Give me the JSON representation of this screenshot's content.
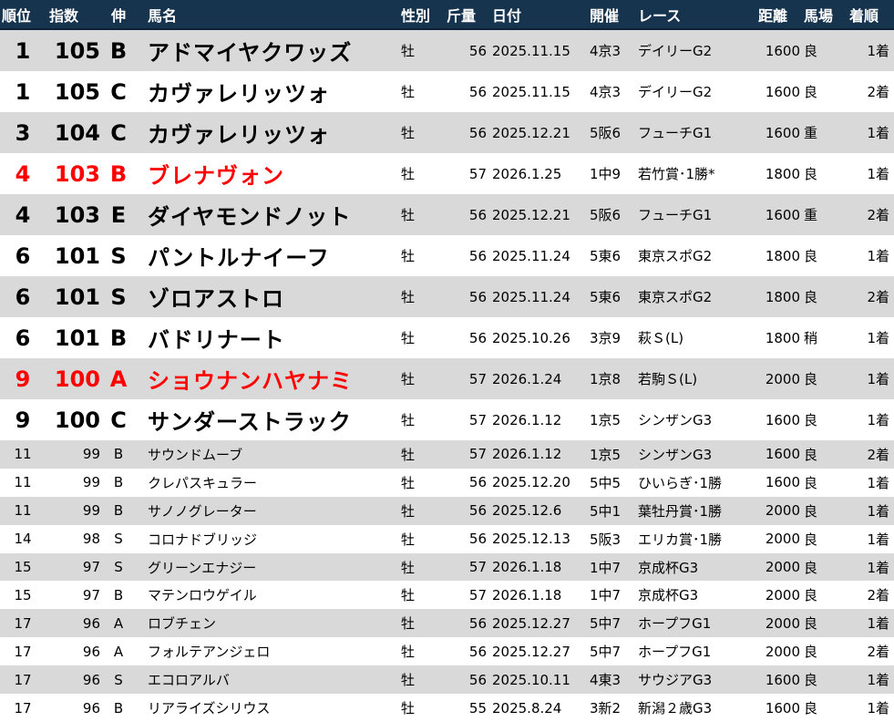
{
  "headers": {
    "rank": "順位",
    "index": "指数",
    "grade": "伸",
    "horse": "馬名",
    "sex": "性別",
    "weight": "斤量",
    "date": "日付",
    "meeting": "開催",
    "race": "レース",
    "distance": "距離",
    "track": "馬場",
    "finish": "着順"
  },
  "colors": {
    "header_bg": "#17344f",
    "stripe": "#d9d9d9",
    "highlight": "#ff0000"
  },
  "rows": [
    {
      "rank": "1",
      "index": "105",
      "grade": "B",
      "horse": "アドマイヤクワッズ",
      "sex": "牡",
      "weight": "56",
      "date": "2025.11.15",
      "meeting": "4京3",
      "race": "デイリーG2",
      "distance": "1600",
      "track": "良",
      "finish": "1着"
    },
    {
      "rank": "1",
      "index": "105",
      "grade": "C",
      "horse": "カヴァレリッツォ",
      "sex": "牡",
      "weight": "56",
      "date": "2025.11.15",
      "meeting": "4京3",
      "race": "デイリーG2",
      "distance": "1600",
      "track": "良",
      "finish": "2着"
    },
    {
      "rank": "3",
      "index": "104",
      "grade": "C",
      "horse": "カヴァレリッツォ",
      "sex": "牡",
      "weight": "56",
      "date": "2025.12.21",
      "meeting": "5阪6",
      "race": "フューチG1",
      "distance": "1600",
      "track": "重",
      "finish": "1着"
    },
    {
      "rank": "4",
      "index": "103",
      "grade": "B",
      "horse": "ブレナヴォン",
      "sex": "牡",
      "weight": "57",
      "date": "2026.1.25",
      "meeting": "1中9",
      "race": "若竹賞･1勝*",
      "distance": "1800",
      "track": "良",
      "finish": "1着"
    },
    {
      "rank": "4",
      "index": "103",
      "grade": "E",
      "horse": "ダイヤモンドノット",
      "sex": "牡",
      "weight": "56",
      "date": "2025.12.21",
      "meeting": "5阪6",
      "race": "フューチG1",
      "distance": "1600",
      "track": "重",
      "finish": "2着"
    },
    {
      "rank": "6",
      "index": "101",
      "grade": "S",
      "horse": "パントルナイーフ",
      "sex": "牡",
      "weight": "56",
      "date": "2025.11.24",
      "meeting": "5東6",
      "race": "東京スポG2",
      "distance": "1800",
      "track": "良",
      "finish": "1着"
    },
    {
      "rank": "6",
      "index": "101",
      "grade": "S",
      "horse": "ゾロアストロ",
      "sex": "牡",
      "weight": "56",
      "date": "2025.11.24",
      "meeting": "5東6",
      "race": "東京スポG2",
      "distance": "1800",
      "track": "良",
      "finish": "2着"
    },
    {
      "rank": "6",
      "index": "101",
      "grade": "B",
      "horse": "バドリナート",
      "sex": "牡",
      "weight": "56",
      "date": "2025.10.26",
      "meeting": "3京9",
      "race": "萩Ｓ(L)",
      "distance": "1800",
      "track": "稍",
      "finish": "1着"
    },
    {
      "rank": "9",
      "index": "100",
      "grade": "A",
      "horse": "ショウナンハヤナミ",
      "sex": "牡",
      "weight": "57",
      "date": "2026.1.24",
      "meeting": "1京8",
      "race": "若駒Ｓ(L)",
      "distance": "2000",
      "track": "良",
      "finish": "1着"
    },
    {
      "rank": "9",
      "index": "100",
      "grade": "C",
      "horse": "サンダーストラック",
      "sex": "牡",
      "weight": "57",
      "date": "2026.1.12",
      "meeting": "1京5",
      "race": "シンザンG3",
      "distance": "1600",
      "track": "良",
      "finish": "1着"
    },
    {
      "rank": "11",
      "index": "99",
      "grade": "B",
      "horse": "サウンドムーブ",
      "sex": "牡",
      "weight": "57",
      "date": "2026.1.12",
      "meeting": "1京5",
      "race": "シンザンG3",
      "distance": "1600",
      "track": "良",
      "finish": "2着"
    },
    {
      "rank": "11",
      "index": "99",
      "grade": "B",
      "horse": "クレパスキュラー",
      "sex": "牡",
      "weight": "56",
      "date": "2025.12.20",
      "meeting": "5中5",
      "race": "ひいらぎ･1勝",
      "distance": "1600",
      "track": "良",
      "finish": "1着"
    },
    {
      "rank": "11",
      "index": "99",
      "grade": "B",
      "horse": "サノノグレーター",
      "sex": "牡",
      "weight": "56",
      "date": "2025.12.6",
      "meeting": "5中1",
      "race": "葉牡丹賞･1勝",
      "distance": "2000",
      "track": "良",
      "finish": "1着"
    },
    {
      "rank": "14",
      "index": "98",
      "grade": "S",
      "horse": "コロナドブリッジ",
      "sex": "牡",
      "weight": "56",
      "date": "2025.12.13",
      "meeting": "5阪3",
      "race": "エリカ賞･1勝",
      "distance": "2000",
      "track": "良",
      "finish": "1着"
    },
    {
      "rank": "15",
      "index": "97",
      "grade": "S",
      "horse": "グリーンエナジー",
      "sex": "牡",
      "weight": "57",
      "date": "2026.1.18",
      "meeting": "1中7",
      "race": "京成杯G3",
      "distance": "2000",
      "track": "良",
      "finish": "1着"
    },
    {
      "rank": "15",
      "index": "97",
      "grade": "B",
      "horse": "マテンロウゲイル",
      "sex": "牡",
      "weight": "57",
      "date": "2026.1.18",
      "meeting": "1中7",
      "race": "京成杯G3",
      "distance": "2000",
      "track": "良",
      "finish": "2着"
    },
    {
      "rank": "17",
      "index": "96",
      "grade": "A",
      "horse": "ロブチェン",
      "sex": "牡",
      "weight": "56",
      "date": "2025.12.27",
      "meeting": "5中7",
      "race": "ホープフG1",
      "distance": "2000",
      "track": "良",
      "finish": "1着"
    },
    {
      "rank": "17",
      "index": "96",
      "grade": "A",
      "horse": "フォルテアンジェロ",
      "sex": "牡",
      "weight": "56",
      "date": "2025.12.27",
      "meeting": "5中7",
      "race": "ホープフG1",
      "distance": "2000",
      "track": "良",
      "finish": "2着"
    },
    {
      "rank": "17",
      "index": "96",
      "grade": "S",
      "horse": "エコロアルバ",
      "sex": "牡",
      "weight": "56",
      "date": "2025.10.11",
      "meeting": "4東3",
      "race": "サウジアG3",
      "distance": "1600",
      "track": "良",
      "finish": "1着"
    },
    {
      "rank": "17",
      "index": "96",
      "grade": "B",
      "horse": "リアライズシリウス",
      "sex": "牡",
      "weight": "55",
      "date": "2025.8.24",
      "meeting": "3新2",
      "race": "新潟２歳G3",
      "distance": "1600",
      "track": "良",
      "finish": "1着"
    }
  ]
}
